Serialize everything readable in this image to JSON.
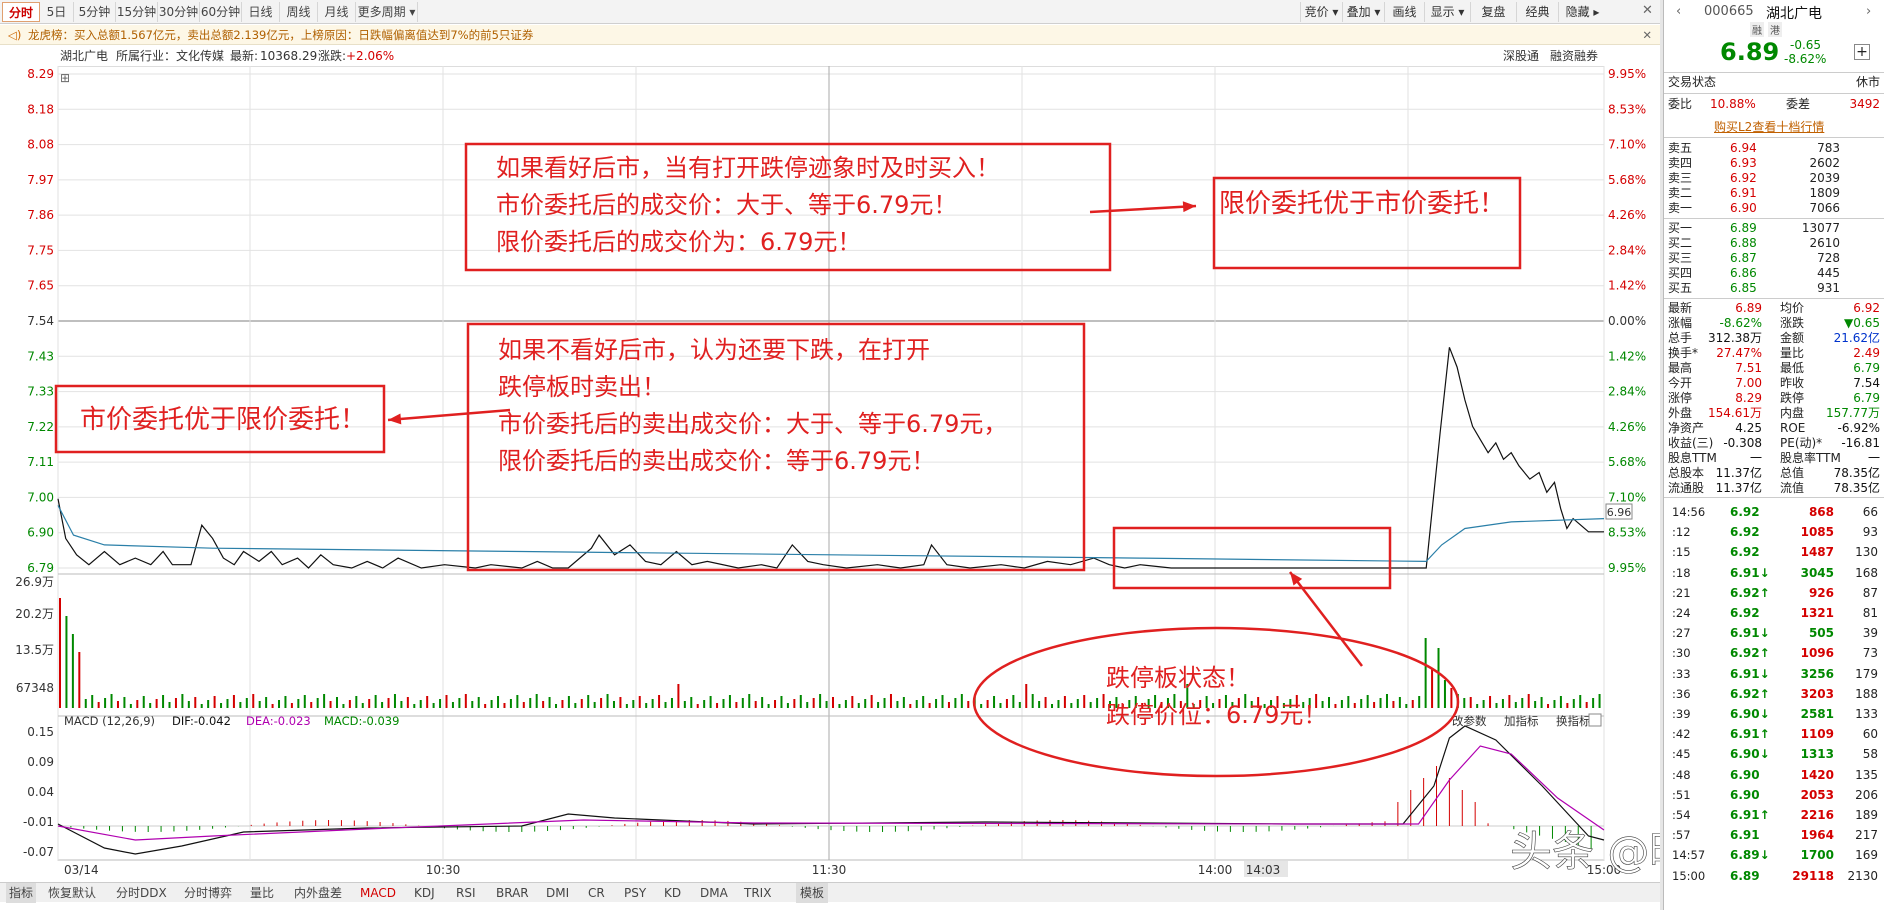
{
  "toolbar": {
    "periods": [
      "分时",
      "5日",
      "5分钟",
      "15分钟",
      "30分钟",
      "60分钟",
      "日线",
      "周线",
      "月线",
      "更多周期"
    ],
    "right": [
      "竞价",
      "叠加",
      "画线",
      "显示",
      "复盘",
      "经典",
      "隐藏"
    ]
  },
  "dragon": "龙虎榜：买入总额1.567亿元，卖出总额2.139亿元，上榜原因：日跌幅偏离值达到7%的前5只证券",
  "info": {
    "name": "湖北广电",
    "industry": "所属行业：文化传媒",
    "latest_label": "最新:",
    "latest": "10368.29",
    "change_label": "涨跌:",
    "change": "+2.06%",
    "links": [
      "深股通",
      "融资融券"
    ]
  },
  "axis": {
    "left_price": [
      "8.29",
      "8.18",
      "8.08",
      "7.97",
      "7.86",
      "7.75",
      "7.65",
      "7.54",
      "7.43",
      "7.33",
      "7.22",
      "7.11",
      "7.00",
      "6.90",
      "6.79"
    ],
    "right_pct": [
      "9.95%",
      "8.53%",
      "7.10%",
      "5.68%",
      "4.26%",
      "2.84%",
      "1.42%",
      "0.00%",
      "1.42%",
      "2.84%",
      "4.26%",
      "5.68%",
      "7.10%",
      "8.53%",
      "9.95%"
    ],
    "vol": [
      "26.9万",
      "20.2万",
      "13.5万",
      "67348"
    ],
    "macd": [
      "0.15",
      "0.09",
      "0.04",
      "-0.01",
      "-0.07"
    ],
    "time": [
      "03/14",
      "10:30",
      "11:30",
      "14:00",
      "14:03",
      "15:00"
    ],
    "price_tag": "6.96"
  },
  "macd_bar": {
    "label": "MACD (12,26,9)",
    "dif": "DIF:-0.042",
    "dea": "DEA:-0.023",
    "macd": "MACD:-0.039",
    "links": [
      "改参数",
      "加指标",
      "换指标"
    ]
  },
  "annotations": {
    "box1": [
      "如果看好后市，当有打开跌停迹象时及时买入！",
      "市价委托后的成交价：大于、等于6.79元！",
      "限价委托后的成交价为：6.79元！"
    ],
    "box2": "限价委托优于市价委托！",
    "box3": [
      "如果不看好后市，认为还要下跌，在打开",
      "跌停板时卖出！",
      "市价委托后的卖出成交价：大于、等于6.79元，",
      "限价委托后的卖出成交价：等于6.79元！"
    ],
    "box4": "市价委托优于限价委托！",
    "ellipse": [
      "跌停板状态！",
      "跌停价位：6.79元！"
    ]
  },
  "indicators": [
    "指标",
    "恢复默认",
    "分时DDX",
    "分时博弈",
    "量比",
    "内外盘差",
    "MACD",
    "KDJ",
    "RSI",
    "BRAR",
    "DMI",
    "CR",
    "PSY",
    "KD",
    "DMA",
    "TRIX",
    "模板"
  ],
  "watermark": "头条 @晓悟会股",
  "side": {
    "code": "000665",
    "name": "湖北广电",
    "tags": [
      "融",
      "港"
    ],
    "price": "6.89",
    "chg": "-0.65",
    "pct": "-8.62%",
    "trade_state_label": "交易状态",
    "trade_state": "休市",
    "wb_label": "委比",
    "wb": "10.88%",
    "wc_label": "委差",
    "wc": "3492",
    "l2": "购买L2查看十档行情",
    "asks": [
      [
        "卖五",
        "6.94",
        "783"
      ],
      [
        "卖四",
        "6.93",
        "2602"
      ],
      [
        "卖三",
        "6.92",
        "2039"
      ],
      [
        "卖二",
        "6.91",
        "1809"
      ],
      [
        "卖一",
        "6.90",
        "7066"
      ]
    ],
    "bids": [
      [
        "买一",
        "6.89",
        "13077"
      ],
      [
        "买二",
        "6.88",
        "2610"
      ],
      [
        "买三",
        "6.87",
        "728"
      ],
      [
        "买四",
        "6.86",
        "445"
      ],
      [
        "买五",
        "6.85",
        "931"
      ]
    ],
    "stats": [
      [
        "最新",
        "6.89",
        "均价",
        "6.92"
      ],
      [
        "涨幅",
        "-8.62%",
        "涨跌",
        "▼0.65"
      ],
      [
        "总手",
        "312.38万",
        "金额",
        "21.62亿"
      ],
      [
        "换手*",
        "27.47%",
        "量比",
        "2.49"
      ],
      [
        "最高",
        "7.51",
        "最低",
        "6.79"
      ],
      [
        "今开",
        "7.00",
        "昨收",
        "7.54"
      ],
      [
        "涨停",
        "8.29",
        "跌停",
        "6.79"
      ],
      [
        "外盘",
        "154.61万",
        "内盘",
        "157.77万"
      ],
      [
        "净资产",
        "4.25",
        "ROE",
        "-6.92%"
      ],
      [
        "收益(三)",
        "-0.308",
        "PE(动)*",
        "-16.81"
      ],
      [
        "股息TTM",
        "一",
        "股息率TTM",
        "一"
      ],
      [
        "总股本",
        "11.37亿",
        "总值",
        "78.35亿"
      ],
      [
        "流通股",
        "11.37亿",
        "流值",
        "78.35亿"
      ]
    ],
    "ticks": [
      [
        "14:56",
        "6.92",
        "868",
        "66"
      ],
      [
        ":12",
        "6.92",
        "1085",
        "93"
      ],
      [
        ":15",
        "6.92",
        "1487",
        "130"
      ],
      [
        ":18",
        "6.91↓",
        "3045",
        "168"
      ],
      [
        ":21",
        "6.92↑",
        "926",
        "87"
      ],
      [
        ":24",
        "6.92",
        "1321",
        "81"
      ],
      [
        ":27",
        "6.91↓",
        "505",
        "39"
      ],
      [
        ":30",
        "6.92↑",
        "1096",
        "73"
      ],
      [
        ":33",
        "6.91↓",
        "3256",
        "179"
      ],
      [
        ":36",
        "6.92↑",
        "3203",
        "188"
      ],
      [
        ":39",
        "6.90↓",
        "2581",
        "133"
      ],
      [
        ":42",
        "6.91↑",
        "1109",
        "60"
      ],
      [
        ":45",
        "6.90↓",
        "1313",
        "58"
      ],
      [
        ":48",
        "6.90",
        "1420",
        "135"
      ],
      [
        ":51",
        "6.90",
        "2053",
        "206"
      ],
      [
        ":54",
        "6.91↑",
        "2216",
        "189"
      ],
      [
        ":57",
        "6.91",
        "1964",
        "217"
      ],
      [
        "14:57",
        "6.89↓",
        "1700",
        "169"
      ],
      [
        "15:00",
        "6.89",
        "29118",
        "2130"
      ]
    ]
  },
  "chart_data": {
    "type": "line",
    "prev_close": 7.54,
    "ylim": [
      6.79,
      8.29
    ],
    "series": []
  }
}
